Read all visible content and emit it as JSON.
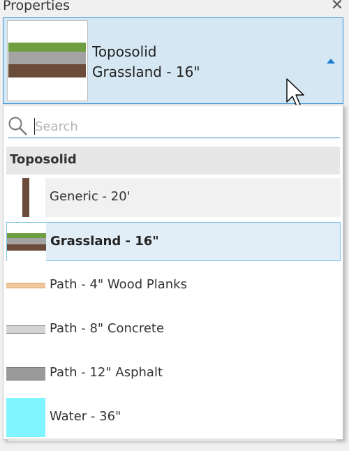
{
  "panel": {
    "title": "Properties",
    "close_glyph": "✕"
  },
  "type_selector": {
    "line1": "Toposolid",
    "line2": "Grassland - 16\"",
    "preview_layers": [
      "#6e9e3f",
      "#a3a3a3",
      "#6b4c3b"
    ]
  },
  "dropdown": {
    "search": {
      "value": "",
      "placeholder": "Search"
    },
    "group_header": "Toposolid",
    "items": [
      {
        "label": "Generic - 20'",
        "state": "hover",
        "swatch": "generic"
      },
      {
        "label": "Grassland - 16\"",
        "state": "selected",
        "swatch": "grassland"
      },
      {
        "label": "Path - 4\" Wood Planks",
        "state": "normal",
        "swatch": "wood"
      },
      {
        "label": "Path - 8\" Concrete",
        "state": "normal",
        "swatch": "concrete"
      },
      {
        "label": "Path - 12\" Asphalt",
        "state": "normal",
        "swatch": "asphalt"
      },
      {
        "label": "Water - 36\"",
        "state": "normal",
        "swatch": "water"
      }
    ]
  },
  "colors": {
    "accent": "#2b8fd6",
    "selected_bg": "#e1eef8",
    "grass": "#6e9e3f",
    "gravel": "#a3a3a3",
    "soil": "#6b4c3b",
    "wood": "#f3c99b",
    "concrete": "#d4d4d4",
    "asphalt": "#9a9a9a",
    "water": "#7ff5ff"
  }
}
